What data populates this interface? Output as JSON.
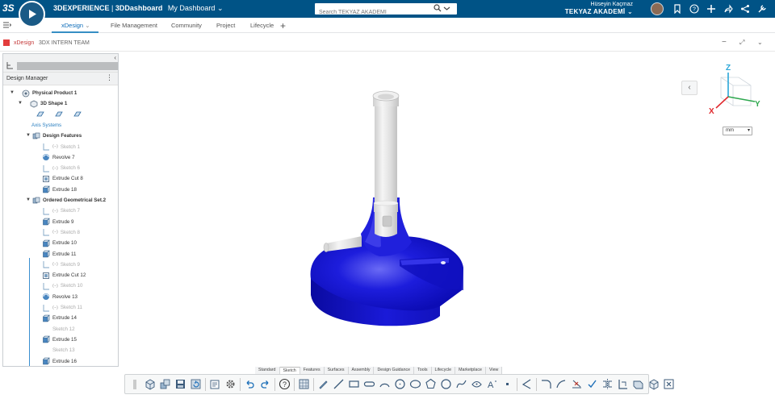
{
  "topbar": {
    "ds_logo": "3S",
    "brand_main": "3DEXPERIENCE",
    "brand_sep": " | ",
    "brand_app": "3DDashboard",
    "brand_dash": "My Dashboard",
    "search_placeholder": "Search TEKYAZ AKADEMİ",
    "user_name": "Hüseyin Kaçmaz",
    "user_org": "TEKYAZ AKADEMİ"
  },
  "tabs": [
    {
      "label": "xDesign",
      "active": true
    },
    {
      "label": "File Management"
    },
    {
      "label": "Community"
    },
    {
      "label": "Project"
    },
    {
      "label": "Lifecycle"
    }
  ],
  "app": {
    "name": "xDesign",
    "title": "3DX INTERN TEAM"
  },
  "panel": {
    "title": "Design Manager"
  },
  "tree": [
    {
      "label": "Physical Product 1",
      "style": "bold",
      "icon": "product-icon"
    },
    {
      "label": "3D Shape 1",
      "style": "bold",
      "icon": "shape-icon"
    },
    {
      "label": "",
      "style": "plane-row",
      "icon": "plane-icons"
    },
    {
      "label": "Axis Systems",
      "style": "link",
      "icon": ""
    },
    {
      "label": "Design Features",
      "style": "bold",
      "icon": "features-icon"
    },
    {
      "label": "Sketch 1",
      "style": "dim",
      "icon": "sketch-icon"
    },
    {
      "label": "Revolve 7",
      "style": "normal",
      "icon": "revolve-icon"
    },
    {
      "label": "Sketch 6",
      "style": "dim",
      "icon": "sketch-icon"
    },
    {
      "label": "Extrude Cut 8",
      "style": "normal",
      "icon": "extrude-cut-icon"
    },
    {
      "label": "Extrude 18",
      "style": "normal",
      "icon": "extrude-icon"
    },
    {
      "label": "Ordered Geometrical Set.2",
      "style": "bold",
      "icon": "set-icon"
    },
    {
      "label": "Sketch 7",
      "style": "dim",
      "icon": "sketch-icon"
    },
    {
      "label": "Extrude 9",
      "style": "normal",
      "icon": "extrude-icon"
    },
    {
      "label": "Sketch 8",
      "style": "dim",
      "icon": "sketch-icon"
    },
    {
      "label": "Extrude 10",
      "style": "normal",
      "icon": "extrude-icon"
    },
    {
      "label": "Extrude 11",
      "style": "normal",
      "icon": "extrude-icon"
    },
    {
      "label": "Sketch 9",
      "style": "dim",
      "icon": "sketch-icon"
    },
    {
      "label": "Extrude Cut 12",
      "style": "normal",
      "icon": "extrude-cut-icon"
    },
    {
      "label": "Sketch 10",
      "style": "dim",
      "icon": "sketch-icon"
    },
    {
      "label": "Revolve 13",
      "style": "normal",
      "icon": "revolve-icon"
    },
    {
      "label": "Sketch 11",
      "style": "dim",
      "icon": "sketch-icon"
    },
    {
      "label": "Extrude 14",
      "style": "normal",
      "icon": "extrude-icon"
    },
    {
      "label": "Sketch 12",
      "style": "dim",
      "icon": ""
    },
    {
      "label": "Extrude 15",
      "style": "normal",
      "icon": "extrude-icon"
    },
    {
      "label": "Sketch 13",
      "style": "dim",
      "icon": ""
    },
    {
      "label": "Extrude 16",
      "style": "normal",
      "icon": "extrude-icon"
    }
  ],
  "viewport": {
    "unit": "mm",
    "axis_x": "X",
    "axis_y": "Y",
    "axis_z": "Z"
  },
  "workshop_tabs": [
    "Standard",
    "Sketch",
    "Features",
    "Surfaces",
    "Assembly",
    "Design Guidance",
    "Tools",
    "Lifecycle",
    "Marketplace",
    "View"
  ],
  "workshop_active": "Sketch",
  "colors": {
    "topbar": "#005386",
    "model_blue": "#1818d8",
    "model_grey": "#e6e6e6",
    "accent": "#368ec4"
  }
}
